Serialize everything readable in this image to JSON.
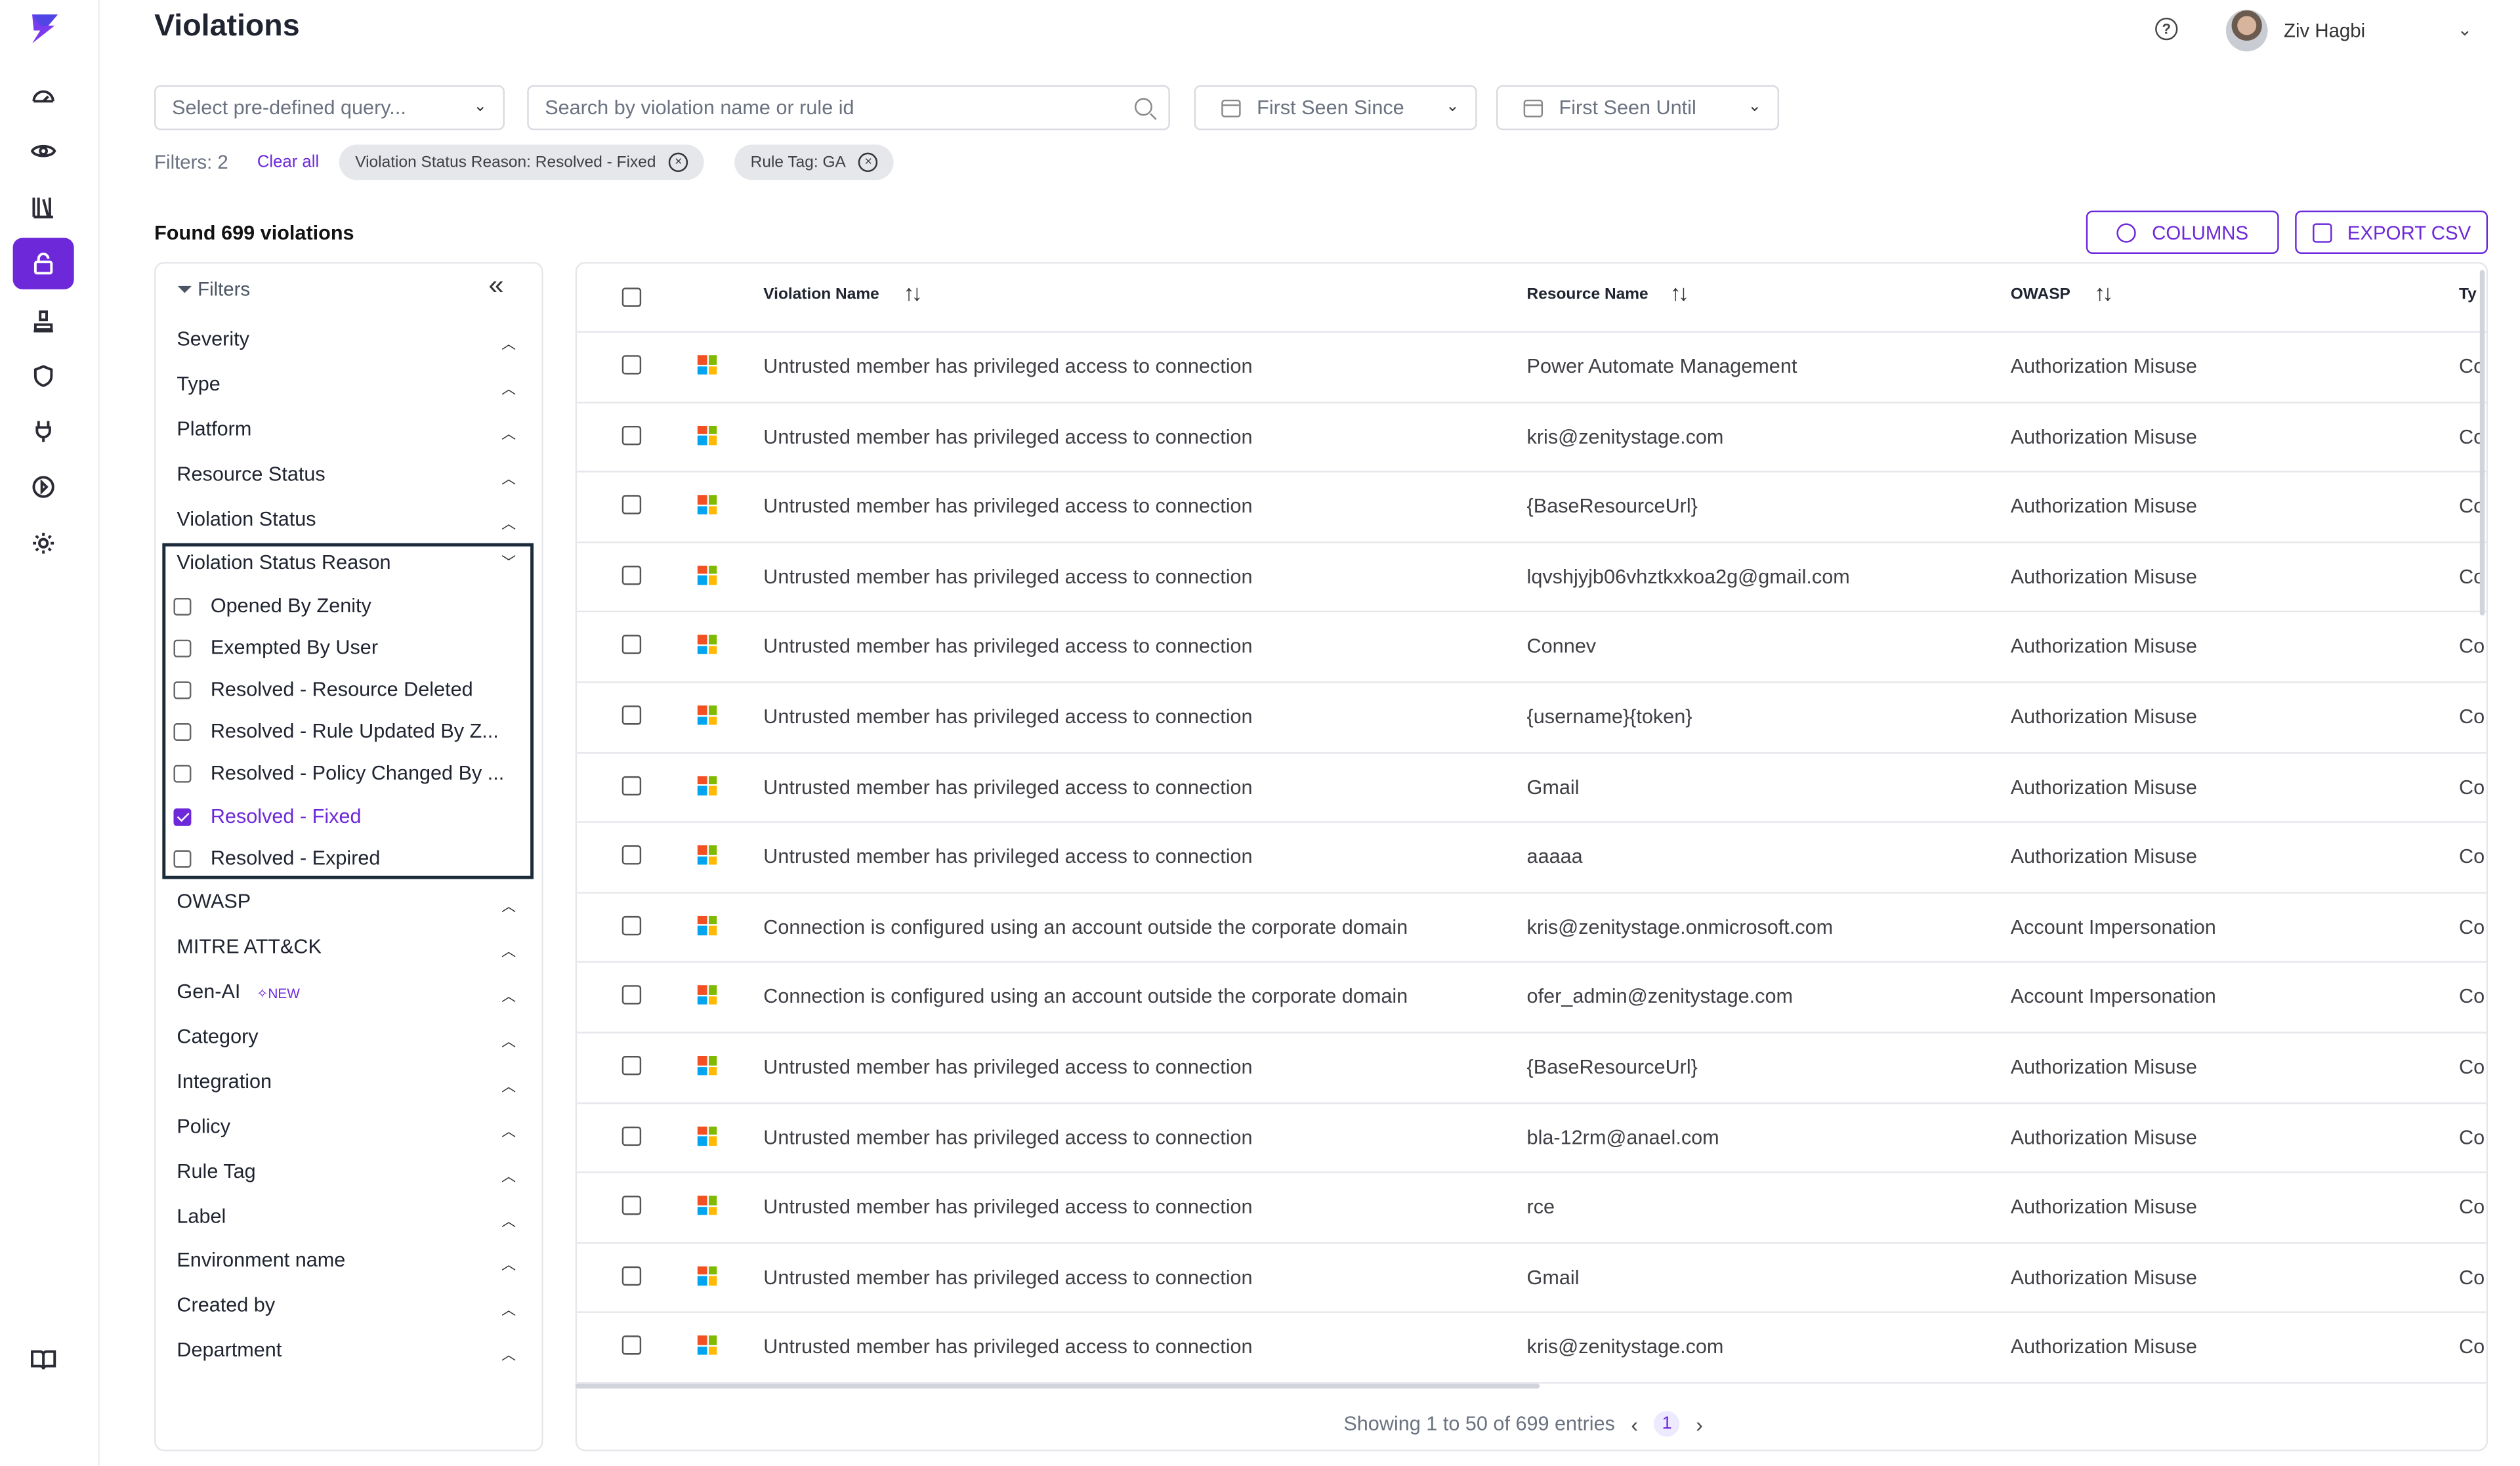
{
  "app": {
    "brand_color": "#6d28d9"
  },
  "header": {
    "title": "Violations",
    "user_name": "Ziv Hagbi"
  },
  "nav": [
    "dashboard-icon",
    "eye-icon",
    "library-icon",
    "violations-icon",
    "stamp-icon",
    "shield-icon",
    "plug-icon",
    "play-icon",
    "gear-icon",
    "book-icon"
  ],
  "toolbar": {
    "query_placeholder": "Select pre-defined query...",
    "search_placeholder": "Search by violation name or rule id",
    "first_seen_since": "First Seen Since",
    "first_seen_until": "First Seen Until",
    "filters_count": "Filters: 2",
    "clear_all": "Clear all",
    "chips": [
      "Violation Status Reason: Resolved - Fixed",
      "Rule Tag: GA"
    ],
    "found": "Found 699 violations",
    "columns_btn": "COLUMNS",
    "export_btn": "EXPORT CSV"
  },
  "filters": {
    "title": "Filters",
    "sections_top": [
      "Severity",
      "Type",
      "Platform",
      "Resource Status",
      "Violation Status"
    ],
    "open_section": "Violation Status Reason",
    "options": [
      {
        "label": "Opened By Zenity",
        "checked": false
      },
      {
        "label": "Exempted By User",
        "checked": false
      },
      {
        "label": "Resolved - Resource Deleted",
        "checked": false
      },
      {
        "label": "Resolved - Rule Updated By Z...",
        "checked": false
      },
      {
        "label": "Resolved - Policy Changed By ...",
        "checked": false
      },
      {
        "label": "Resolved - Fixed",
        "checked": true
      },
      {
        "label": "Resolved - Expired",
        "checked": false
      }
    ],
    "sections_bottom": [
      "OWASP",
      "MITRE ATT&CK",
      "Gen-AI",
      "Category",
      "Integration",
      "Policy",
      "Rule Tag",
      "Label",
      "Environment name",
      "Created by",
      "Department"
    ],
    "new_tag": "✧NEW"
  },
  "table": {
    "columns": [
      "Violation Name",
      "Resource Name",
      "OWASP",
      "Ty"
    ],
    "rows": [
      {
        "name": "Untrusted member has privileged access to connection",
        "resource": "Power Automate Management",
        "owasp": "Authorization Misuse",
        "type": "Co"
      },
      {
        "name": "Untrusted member has privileged access to connection",
        "resource": "kris@zenitystage.com",
        "owasp": "Authorization Misuse",
        "type": "Co"
      },
      {
        "name": "Untrusted member has privileged access to connection",
        "resource": "{BaseResourceUrl}",
        "owasp": "Authorization Misuse",
        "type": "Co"
      },
      {
        "name": "Untrusted member has privileged access to connection",
        "resource": "lqvshjyjb06vhztkxkoa2g@gmail.com",
        "owasp": "Authorization Misuse",
        "type": "Co"
      },
      {
        "name": "Untrusted member has privileged access to connection",
        "resource": "Connev",
        "owasp": "Authorization Misuse",
        "type": "Co"
      },
      {
        "name": "Untrusted member has privileged access to connection",
        "resource": "{username}{token}",
        "owasp": "Authorization Misuse",
        "type": "Co"
      },
      {
        "name": "Untrusted member has privileged access to connection",
        "resource": "Gmail",
        "owasp": "Authorization Misuse",
        "type": "Co"
      },
      {
        "name": "Untrusted member has privileged access to connection",
        "resource": "aaaaa",
        "owasp": "Authorization Misuse",
        "type": "Co"
      },
      {
        "name": "Connection is configured using an account outside the corporate domain",
        "resource": "kris@zenitystage.onmicrosoft.com",
        "owasp": "Account Impersonation",
        "type": "Co"
      },
      {
        "name": "Connection is configured using an account outside the corporate domain",
        "resource": "ofer_admin@zenitystage.com",
        "owasp": "Account Impersonation",
        "type": "Co"
      },
      {
        "name": "Untrusted member has privileged access to connection",
        "resource": "{BaseResourceUrl}",
        "owasp": "Authorization Misuse",
        "type": "Co"
      },
      {
        "name": "Untrusted member has privileged access to connection",
        "resource": "bla-12rm@anael.com",
        "owasp": "Authorization Misuse",
        "type": "Co"
      },
      {
        "name": "Untrusted member has privileged access to connection",
        "resource": "rce",
        "owasp": "Authorization Misuse",
        "type": "Co"
      },
      {
        "name": "Untrusted member has privileged access to connection",
        "resource": "Gmail",
        "owasp": "Authorization Misuse",
        "type": "Co"
      },
      {
        "name": "Untrusted member has privileged access to connection",
        "resource": "kris@zenitystage.com",
        "owasp": "Authorization Misuse",
        "type": "Co"
      }
    ],
    "pagination": {
      "text": "Showing 1 to 50 of 699 entries",
      "page": "1"
    }
  }
}
